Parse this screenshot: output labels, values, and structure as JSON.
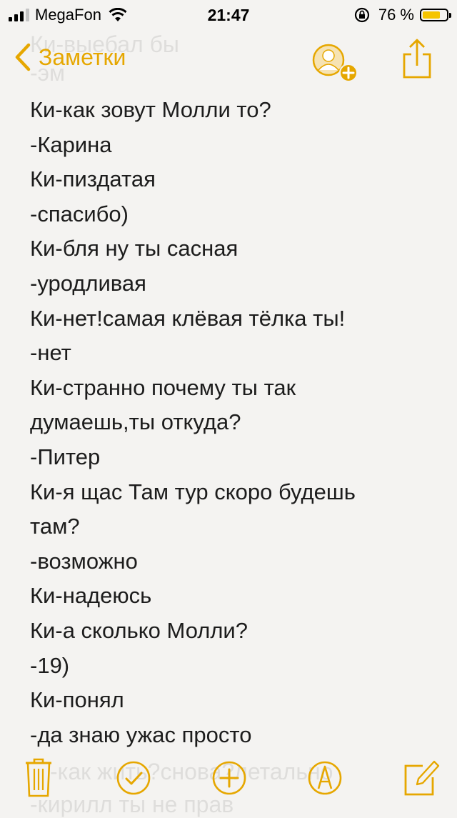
{
  "status_bar": {
    "carrier": "MegaFon",
    "time": "21:47",
    "battery_percent": "76 %",
    "battery_level": 0.76,
    "signal_bars_filled": 3,
    "signal_bars_total": 4,
    "icons": [
      "signal-icon",
      "wifi-icon",
      "rotation-lock-icon",
      "battery-icon"
    ]
  },
  "nav": {
    "back_label": "Заметки",
    "accent_color": "#e6a700",
    "icons": [
      "chevron-left-icon",
      "add-person-icon",
      "share-icon"
    ]
  },
  "ghost_text": {
    "top": "Ки-выебал бы",
    "top2": "-эм",
    "bottom": "-как жить?снова?летально",
    "bottom2": "-кирилл ты не прав"
  },
  "note": {
    "lines": [
      "Ки-как зовут Молли то?",
      "-Карина",
      "Ки-пиздатая",
      "-спасибо)",
      "Ки-бля ну ты сасная",
      "-уродливая",
      "Ки-нет!самая клёвая тёлка ты!",
      "-нет",
      "Ки-странно почему ты так",
      "думаешь,ты откуда?",
      "-Питер",
      "Ки-я щас Там тур скоро будешь",
      "там?",
      "-возможно",
      "Ки-надеюсь",
      "Ки-а сколько Молли?",
      "-19)",
      "Ки-понял",
      "-да знаю ужас просто"
    ]
  },
  "toolbar": {
    "icons": [
      "trash-icon",
      "checklist-icon",
      "add-icon",
      "markup-icon",
      "compose-icon"
    ]
  }
}
